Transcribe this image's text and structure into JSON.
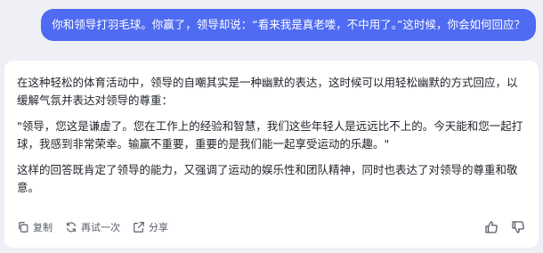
{
  "user_message": "你和领导打羽毛球。你赢了，领导却说：“看来我是真老喽，不中用了。”这时候，你会如何回应？",
  "reply": {
    "paragraphs": [
      "在这种轻松的体育活动中，领导的自嘲其实是一种幽默的表达，这时候可以用轻松幽默的方式回应，以缓解气氛并表达对领导的尊重：",
      "\"领导，您这是谦虚了。您在工作上的经验和智慧，我们这些年轻人是远远比不上的。今天能和您一起打球，我感到非常荣幸。输赢不重要，重要的是我们能一起享受运动的乐趣。\"",
      "这样的回答既肯定了领导的能力，又强调了运动的娱乐性和团队精神，同时也表达了对领导的尊重和敬意。"
    ]
  },
  "actions": {
    "copy_label": "复制",
    "retry_label": "再试一次",
    "share_label": "分享"
  },
  "icons": {
    "copy": "copy-icon",
    "retry": "refresh-icon",
    "share": "share-icon",
    "like": "thumbs-up-icon",
    "dislike": "thumbs-down-icon"
  },
  "colors": {
    "user_bubble": "#4f6bf2",
    "background": "#eef0f5",
    "card": "#ffffff"
  }
}
